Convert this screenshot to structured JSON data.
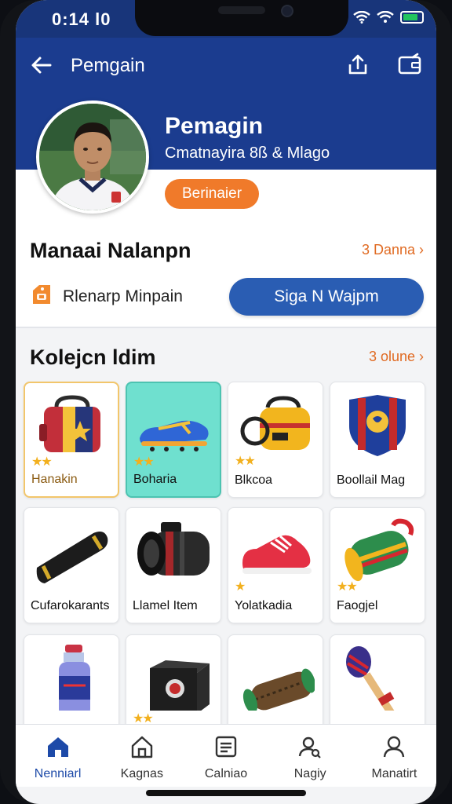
{
  "status": {
    "time": "0:14 l0"
  },
  "header": {
    "title": "Pemgain"
  },
  "profile": {
    "name": "Pemagin",
    "subtitle": "Cmatnayira 8ß & Mlago",
    "badge": "Berinaier"
  },
  "manage": {
    "title": "Manaai Nalanpn",
    "link": "3 Danna ›",
    "tag_text": "Rlenarp Minpain",
    "button": "Siga N Wajpm"
  },
  "collection": {
    "title": "Kolejcn ldim",
    "link": "3 olune ›",
    "items": [
      {
        "label": "Hanakin",
        "stars": "★★"
      },
      {
        "label": "Boharia",
        "stars": "★★"
      },
      {
        "label": "Blkcoa",
        "stars": "★★"
      },
      {
        "label": "Boollail Mag",
        "stars": ""
      },
      {
        "label": "Cufarokarants",
        "stars": ""
      },
      {
        "label": "Llamel Item",
        "stars": ""
      },
      {
        "label": "Yolatkadia",
        "stars": "★"
      },
      {
        "label": "Faogjel",
        "stars": "★★"
      },
      {
        "label": "",
        "stars": ""
      },
      {
        "label": "",
        "stars": "★★"
      },
      {
        "label": "",
        "stars": ""
      },
      {
        "label": "",
        "stars": ""
      }
    ]
  },
  "nav": [
    {
      "label": "Nenniarl"
    },
    {
      "label": "Kagnas"
    },
    {
      "label": "Calniao"
    },
    {
      "label": "Nagiy"
    },
    {
      "label": "Manatirt"
    }
  ],
  "colors": {
    "header_blue": "#1b3c8f",
    "accent_orange": "#f07a2a",
    "button_blue": "#2a5db3",
    "teal_card": "#6fe0cf"
  }
}
